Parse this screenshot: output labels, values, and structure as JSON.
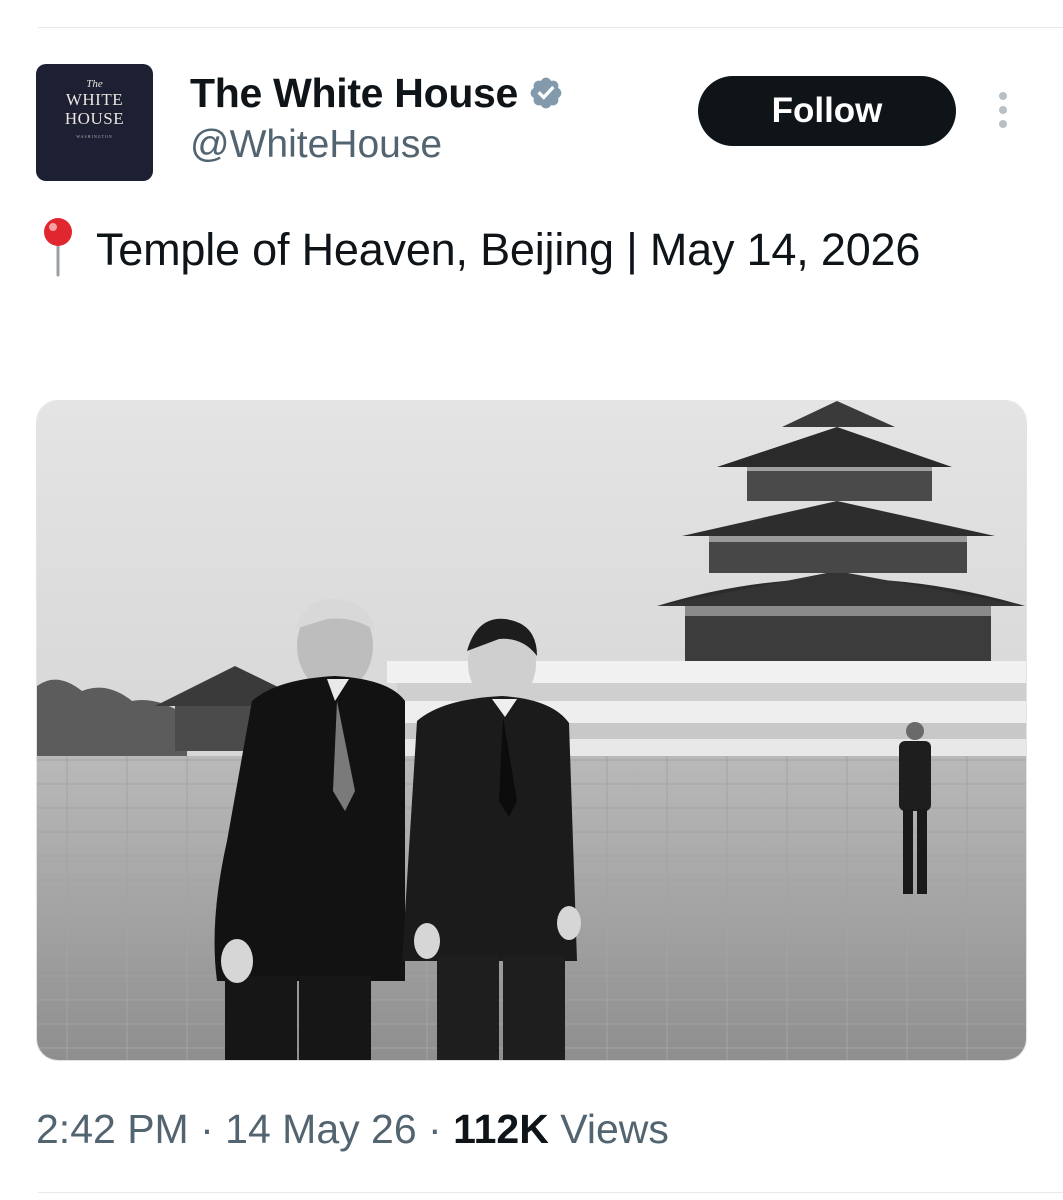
{
  "author": {
    "display_name": "The White House",
    "handle": "@WhiteHouse",
    "verified_badge_icon": "verified-badge-icon",
    "avatar": {
      "line1": "The",
      "line2": "WHITE",
      "line3": "HOUSE",
      "line4": "WASHINGTON"
    }
  },
  "actions": {
    "follow_label": "Follow",
    "more_icon": "more-vertical-icon"
  },
  "tweet": {
    "emoji_icon": "round-pushpin-icon",
    "text": "Temple of Heaven, Beijing | May 14, 2026"
  },
  "media": {
    "type": "black-and-white photo"
  },
  "meta": {
    "time": "2:42 PM",
    "separator": "·",
    "date": "14 May 26",
    "views_count": "112K",
    "views_label": "Views"
  },
  "colors": {
    "text_primary": "#0f1419",
    "text_secondary": "#536471",
    "follow_button_bg": "#0f1419",
    "verified_badge": "#829aab",
    "avatar_bg": "#1d1f33",
    "pin_red": "#e0262f"
  }
}
